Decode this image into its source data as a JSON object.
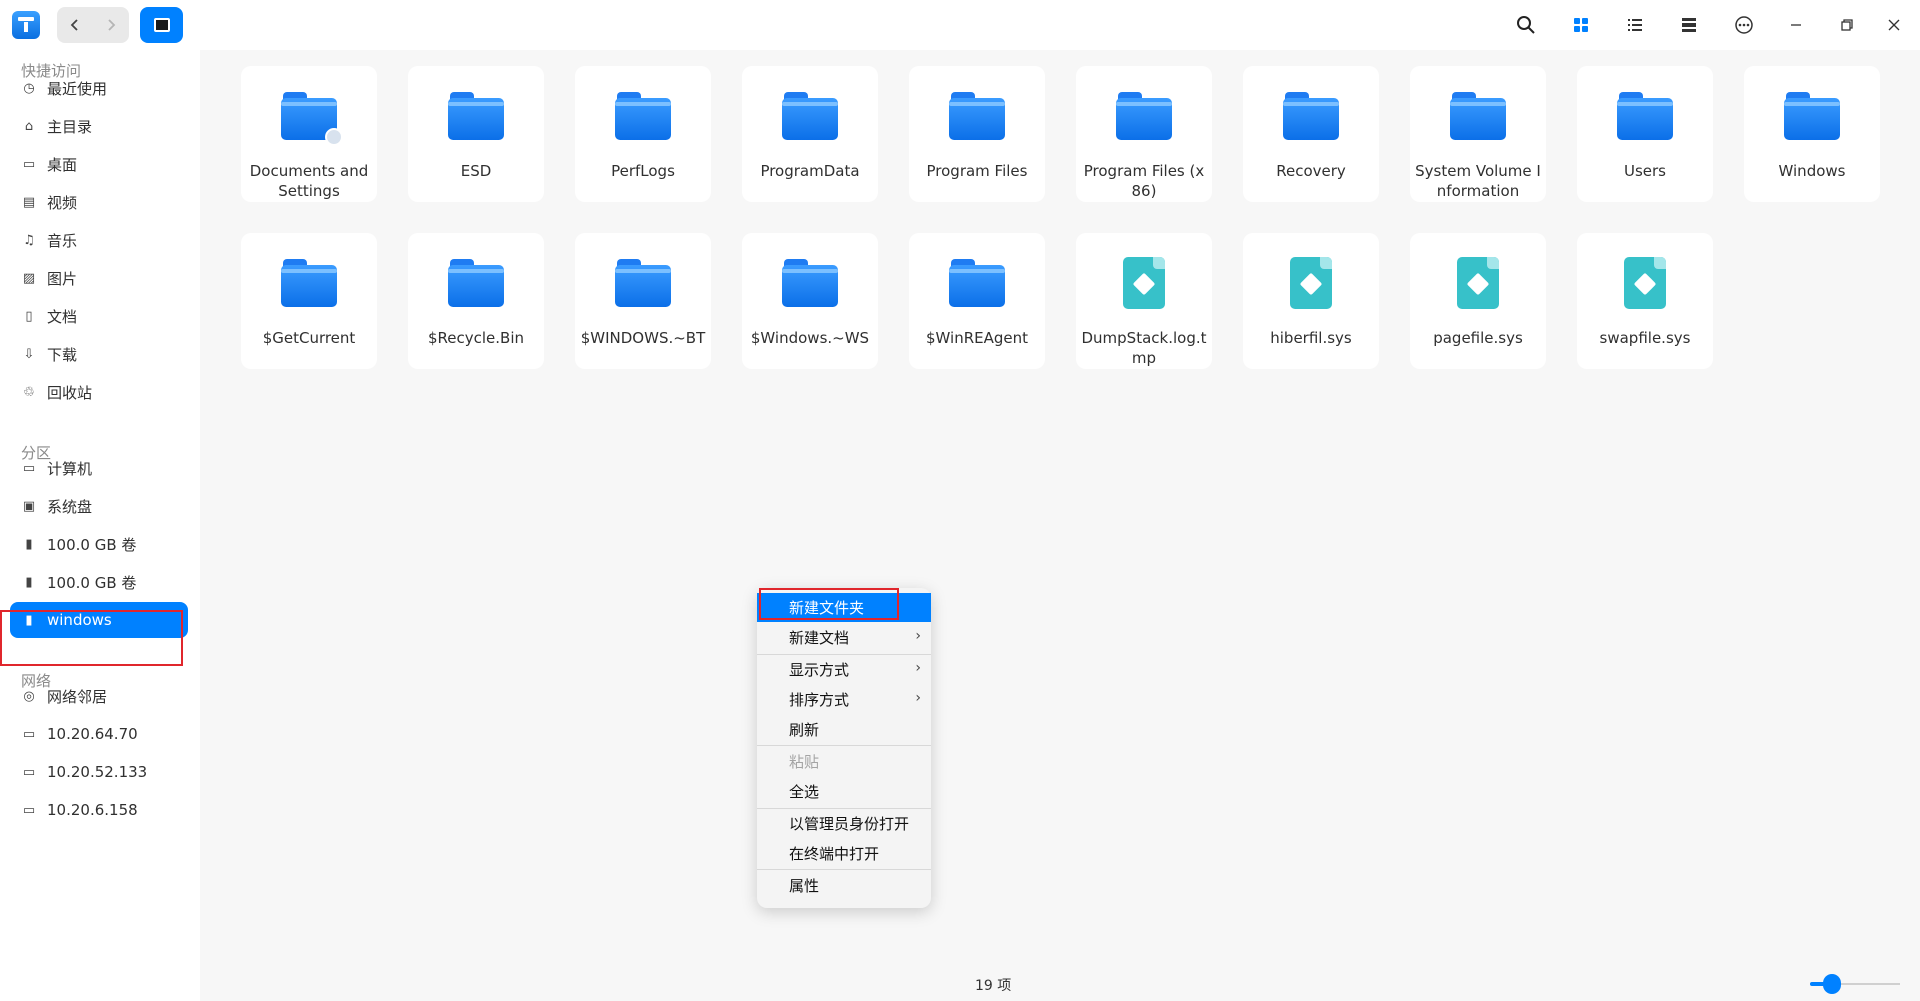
{
  "sidebar": {
    "sections": [
      "快捷访问",
      "分区",
      "网络"
    ],
    "quick": [
      {
        "label": "最近使用",
        "icon": "clock-icon"
      },
      {
        "label": "主目录",
        "icon": "home-icon"
      },
      {
        "label": "桌面",
        "icon": "desktop-icon"
      },
      {
        "label": "视频",
        "icon": "video-icon"
      },
      {
        "label": "音乐",
        "icon": "music-icon"
      },
      {
        "label": "图片",
        "icon": "picture-icon"
      },
      {
        "label": "文档",
        "icon": "document-icon"
      },
      {
        "label": "下载",
        "icon": "download-icon"
      },
      {
        "label": "回收站",
        "icon": "trash-icon"
      }
    ],
    "partitions": [
      {
        "label": "计算机",
        "icon": "computer-icon"
      },
      {
        "label": "系统盘",
        "icon": "system-disk-icon"
      },
      {
        "label": "100.0 GB 卷",
        "icon": "disk-icon"
      },
      {
        "label": "100.0 GB 卷",
        "icon": "disk-icon"
      },
      {
        "label": "windows",
        "icon": "disk-icon",
        "active": true
      }
    ],
    "network": [
      {
        "label": "网络邻居",
        "icon": "network-icon"
      },
      {
        "label": "10.20.64.70",
        "icon": "folder-outline-icon"
      },
      {
        "label": "10.20.52.133",
        "icon": "folder-outline-icon"
      },
      {
        "label": "10.20.6.158",
        "icon": "folder-outline-icon"
      }
    ]
  },
  "files": [
    {
      "name": "Documents and Settings",
      "kind": "folder-link"
    },
    {
      "name": "ESD",
      "kind": "folder"
    },
    {
      "name": "PerfLogs",
      "kind": "folder"
    },
    {
      "name": "ProgramData",
      "kind": "folder"
    },
    {
      "name": "Program Files",
      "kind": "folder"
    },
    {
      "name": "Program Files (x86)",
      "kind": "folder"
    },
    {
      "name": "Recovery",
      "kind": "folder"
    },
    {
      "name": "System Volume Information",
      "kind": "folder"
    },
    {
      "name": "Users",
      "kind": "folder"
    },
    {
      "name": "Windows",
      "kind": "folder"
    },
    {
      "name": "$GetCurrent",
      "kind": "folder"
    },
    {
      "name": "$Recycle.Bin",
      "kind": "folder"
    },
    {
      "name": "$WINDOWS.~BT",
      "kind": "folder"
    },
    {
      "name": "$Windows.~WS",
      "kind": "folder"
    },
    {
      "name": "$WinREAgent",
      "kind": "folder"
    },
    {
      "name": "DumpStack.log.tmp",
      "kind": "file"
    },
    {
      "name": "hiberfil.sys",
      "kind": "file"
    },
    {
      "name": "pagefile.sys",
      "kind": "file"
    },
    {
      "name": "swapfile.sys",
      "kind": "file"
    }
  ],
  "context_menu": {
    "items": [
      {
        "label": "新建文件夹",
        "highlighted": true
      },
      {
        "label": "新建文档",
        "submenu": true
      },
      {
        "label": "显示方式",
        "submenu": true
      },
      {
        "label": "排序方式",
        "submenu": true
      },
      {
        "label": "刷新"
      },
      {
        "label": "粘贴",
        "disabled": true
      },
      {
        "label": "全选"
      },
      {
        "label": "以管理员身份打开"
      },
      {
        "label": "在终端中打开"
      },
      {
        "label": "属性"
      }
    ]
  },
  "status": {
    "item_count": "19 项"
  },
  "toolbar": {
    "view_mode": "icon"
  },
  "colors": {
    "accent": "#0081ff",
    "highlight_box": "#e0262c",
    "file_icon": "#37c1c9"
  }
}
